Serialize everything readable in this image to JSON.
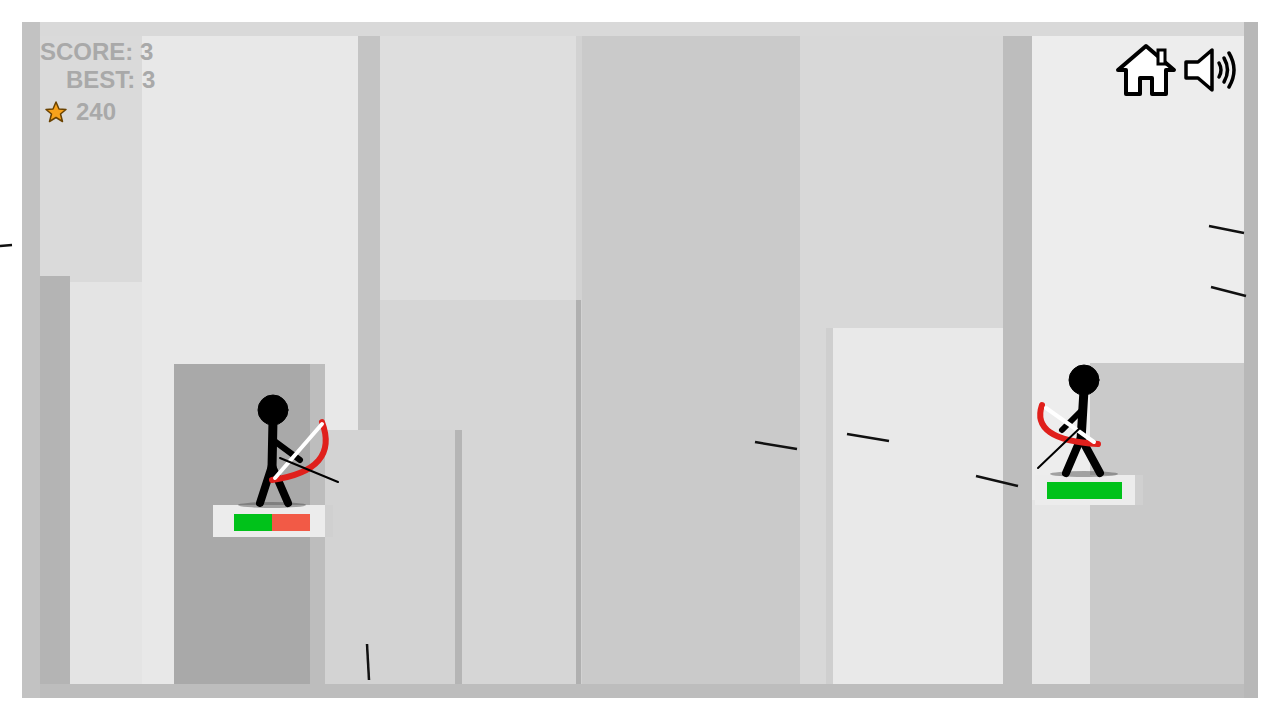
{
  "hud": {
    "score": "SCORE: 3",
    "best": "BEST: 3",
    "stars": "240"
  },
  "controls": {
    "home": {
      "kind": "button"
    },
    "sound": {
      "on": true
    }
  },
  "players": [
    {
      "role": "player",
      "side": "left",
      "level": 0.5
    },
    {
      "role": "enemy",
      "side": "right",
      "level": 1.0
    }
  ]
}
